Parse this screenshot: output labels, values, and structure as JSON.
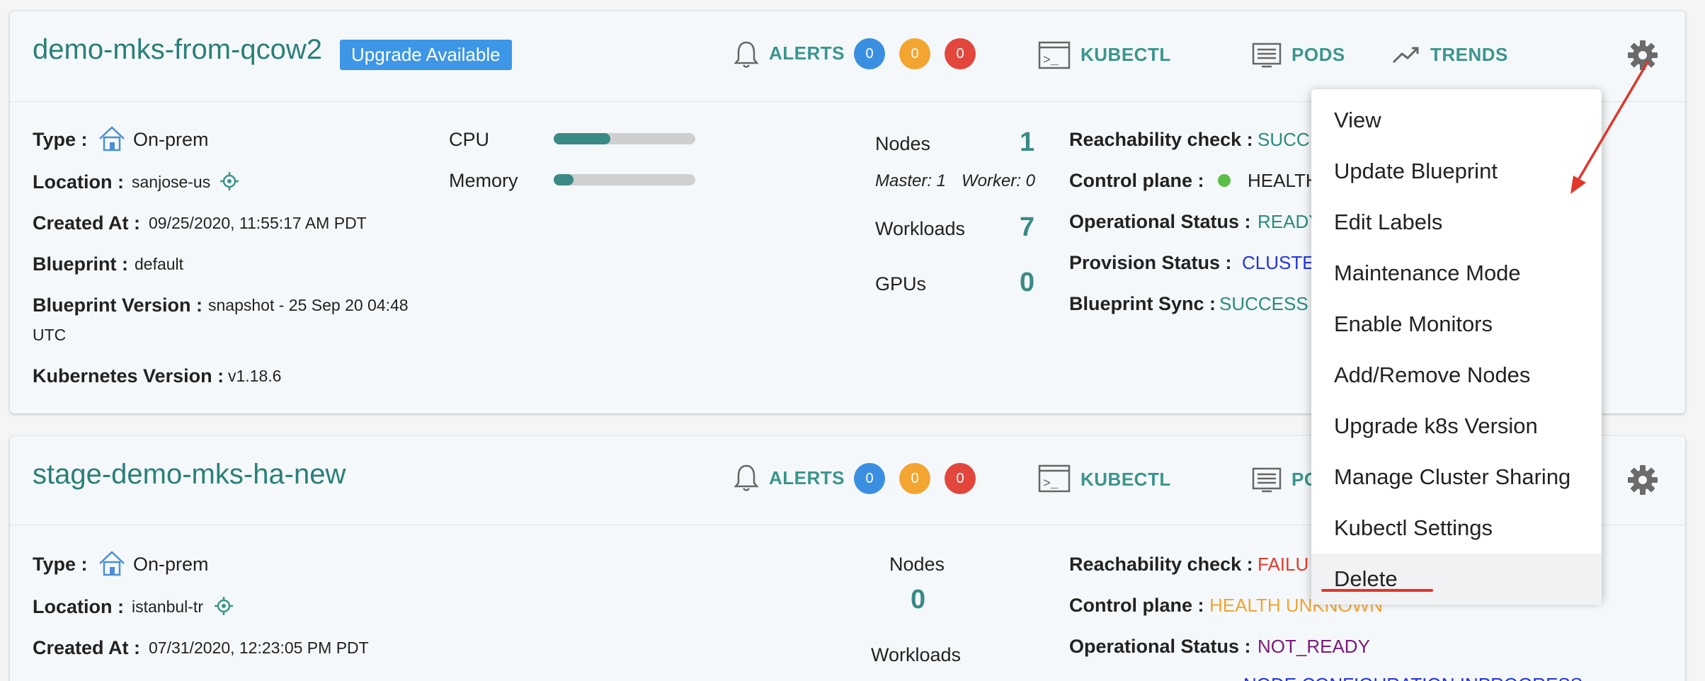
{
  "colors": {
    "accent": "#2a7f79",
    "link": "#3a958d",
    "badge": "#3d96e6",
    "success": "#2b8a7e",
    "failure": "#e53a2f",
    "warning": "#f2a531",
    "info": "#2233dd",
    "purple": "#7a1a7a"
  },
  "cluster1": {
    "name": "demo-mks-from-qcow2",
    "badge": "Upgrade Available",
    "alerts_label": "ALERTS",
    "alert_counts": [
      "0",
      "0",
      "0"
    ],
    "kubectl_label": "KUBECTL",
    "pods_label": "PODS",
    "trends_label": "TRENDS",
    "type_label": "Type :",
    "type_value": "On-prem",
    "location_label": "Location :",
    "location_value": "sanjose-us",
    "created_label": "Created At :",
    "created_value": "09/25/2020, 11:55:17 AM PDT",
    "blueprint_label": "Blueprint :",
    "blueprint_value": "default",
    "bp_version_label": "Blueprint Version :",
    "bp_version_value_1": "snapshot - 25 Sep 20 04:48",
    "bp_version_value_2": "UTC",
    "k8s_label": "Kubernetes Version :",
    "k8s_value": "v1.18.6",
    "cpu_label": "CPU",
    "cpu_fraction": 0.4,
    "memory_label": "Memory",
    "memory_fraction": 0.14,
    "nodes_label": "Nodes",
    "nodes_value": "1",
    "master_label": "Master: 1",
    "worker_label": "Worker: 0",
    "workloads_label": "Workloads",
    "workloads_value": "7",
    "gpus_label": "GPUs",
    "gpus_value": "0",
    "reach_label": "Reachability check :",
    "reach_value": "SUCC",
    "control_label": "Control plane :",
    "control_value": "HEALTH",
    "op_label": "Operational Status :",
    "op_value": "READY",
    "prov_label": "Provision Status :",
    "prov_value": "CLUSTE",
    "sync_label": "Blueprint Sync :",
    "sync_value": "SUCCESS"
  },
  "cluster2": {
    "name": "stage-demo-mks-ha-new",
    "alerts_label": "ALERTS",
    "alert_counts": [
      "0",
      "0",
      "0"
    ],
    "kubectl_label": "KUBECTL",
    "pods_label": "PO",
    "type_label": "Type :",
    "type_value": "On-prem",
    "location_label": "Location :",
    "location_value": "istanbul-tr",
    "created_label": "Created At :",
    "created_value": "07/31/2020, 12:23:05 PM PDT",
    "nodes_label": "Nodes",
    "nodes_value": "0",
    "workloads_label": "Workloads",
    "reach_label": "Reachability check :",
    "reach_value": "FAILU",
    "control_label": "Control plane :",
    "control_value": "HEALTH UNKNOWN",
    "op_label": "Operational Status :",
    "op_value": "NOT_READY",
    "prov_value": "NODE CONFIGURATION INPROGRESS"
  },
  "menu": {
    "items": [
      "View",
      "Update Blueprint",
      "Edit Labels",
      "Maintenance Mode",
      "Enable Monitors",
      "Add/Remove Nodes",
      "Upgrade k8s Version",
      "Manage Cluster Sharing",
      "Kubectl Settings",
      "Delete"
    ],
    "highlighted": "Delete"
  },
  "icons": {
    "bell": "bell-icon",
    "terminal": "terminal-icon",
    "pods": "list-icon",
    "trends": "trend-icon",
    "gear": "gear-icon",
    "home": "home-icon",
    "location": "location-icon"
  }
}
